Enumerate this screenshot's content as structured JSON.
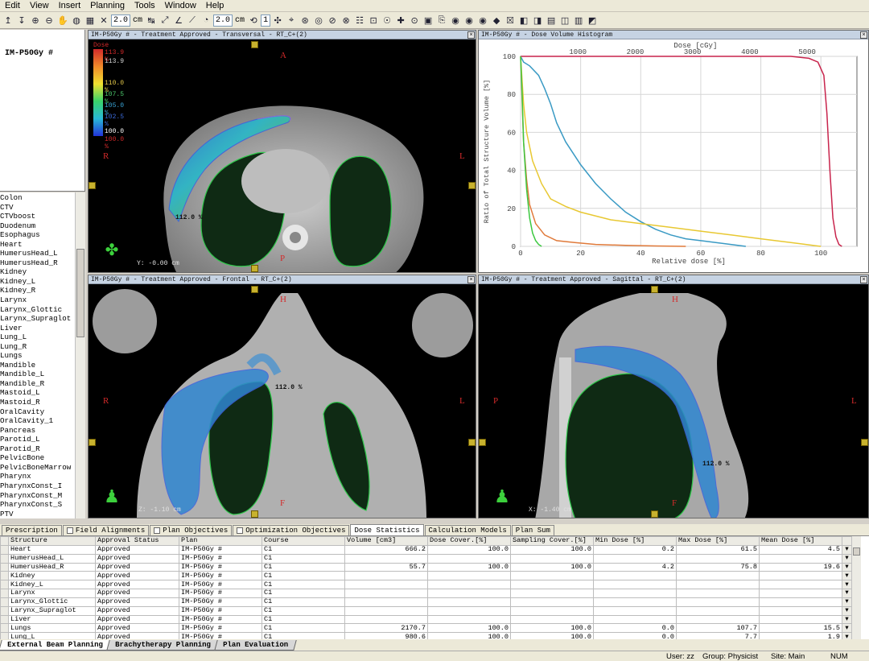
{
  "menu": [
    "Edit",
    "View",
    "Insert",
    "Planning",
    "Tools",
    "Window",
    "Help"
  ],
  "toolbar": {
    "zoom_value": "2.0",
    "zoom_unit": "cm",
    "dist_value": "2.0",
    "dist_unit": "cm",
    "index_value": "1"
  },
  "plan_name": "IM-P50Gy #",
  "structures": [
    "Colon",
    "CTV",
    "CTVboost",
    "Duodenum",
    "Esophagus",
    "Heart",
    "HumerusHead_L",
    "HumerusHead_R",
    "Kidney",
    "Kidney_L",
    "Kidney_R",
    "Larynx",
    "Larynx_Glottic",
    "Larynx_Supraglot",
    "Liver",
    "Lung_L",
    "Lung_R",
    "Lungs",
    "Mandible",
    "Mandible_L",
    "Mandible_R",
    "Mastoid_L",
    "Mastoid_R",
    "OralCavity",
    "OralCavity_1",
    "Pancreas",
    "Parotid_L",
    "Parotid_R",
    "PelvicBone",
    "PelvicBoneMarrow",
    "Pharynx",
    "PharynxConst_I",
    "PharynxConst_M",
    "PharynxConst_S",
    "PTV"
  ],
  "views": {
    "transversal": {
      "title": "IM-P50Gy #  -  Treatment Approved - Transversal - RT_C+(2)",
      "top": "A",
      "bottom": "P",
      "left": "R",
      "right": "L",
      "coord": "Y: -0.00 cm",
      "maxdose": "112.0 %"
    },
    "frontal": {
      "title": "IM-P50Gy #  -  Treatment Approved - Frontal - RT_C+(2)",
      "top": "H",
      "bottom": "F",
      "left": "R",
      "right": "L",
      "coord": "Z: -1.10 cm",
      "maxdose": "112.0 %"
    },
    "sagittal": {
      "title": "IM-P50Gy #  -  Treatment Approved - Sagittal - RT_C+(2)",
      "top": "H",
      "bottom": "F",
      "left": "P",
      "right": "L",
      "coord": "X: -1.40 cm",
      "maxdose": "112.0 %"
    }
  },
  "dose_legend": {
    "title": "Dose",
    "levels": [
      "113.9 %",
      "113.9",
      "110.0 %",
      "107.5 %",
      "105.0 %",
      "102.5 %",
      "100.0",
      "100.0 %"
    ]
  },
  "dvh": {
    "title": "IM-P50Gy #  -  Dose Volume Histogram",
    "chart_data": {
      "type": "line",
      "title": "",
      "xlabel": "Relative dose [%]",
      "x2label": "Dose [cGy]",
      "ylabel": "Ratio of Total Structure Volume [%]",
      "xlim": [
        0,
        112
      ],
      "ylim": [
        0,
        100
      ],
      "xticks": [
        0,
        20,
        40,
        60,
        80,
        100
      ],
      "x2ticks": [
        1000,
        2000,
        3000,
        4000,
        5000
      ],
      "yticks": [
        0,
        20,
        40,
        60,
        80,
        100
      ],
      "grid": true,
      "series": [
        {
          "color": "#c8244c",
          "points": [
            [
              0,
              100
            ],
            [
              90,
              100
            ],
            [
              96,
              99
            ],
            [
              99,
              97
            ],
            [
              101,
              90
            ],
            [
              102,
              70
            ],
            [
              103,
              40
            ],
            [
              104,
              15
            ],
            [
              105,
              5
            ],
            [
              106,
              1
            ],
            [
              107,
              0
            ]
          ]
        },
        {
          "color": "#3a9ac4",
          "points": [
            [
              0,
              100
            ],
            [
              1,
              97
            ],
            [
              3,
              95
            ],
            [
              6,
              90
            ],
            [
              8,
              83
            ],
            [
              10,
              75
            ],
            [
              12,
              65
            ],
            [
              15,
              55
            ],
            [
              20,
              43
            ],
            [
              25,
              33
            ],
            [
              30,
              25
            ],
            [
              35,
              18
            ],
            [
              40,
              13
            ],
            [
              45,
              9
            ],
            [
              50,
              6
            ],
            [
              55,
              4
            ],
            [
              60,
              3
            ],
            [
              65,
              2
            ],
            [
              70,
              1
            ],
            [
              75,
              0
            ]
          ]
        },
        {
          "color": "#e8c832",
          "points": [
            [
              0,
              100
            ],
            [
              1,
              75
            ],
            [
              2,
              60
            ],
            [
              4,
              45
            ],
            [
              7,
              33
            ],
            [
              10,
              25
            ],
            [
              15,
              21
            ],
            [
              20,
              18
            ],
            [
              30,
              14
            ],
            [
              40,
              12
            ],
            [
              50,
              10
            ],
            [
              60,
              8
            ],
            [
              70,
              6
            ],
            [
              80,
              4
            ],
            [
              90,
              2
            ],
            [
              95,
              1
            ],
            [
              100,
              0
            ]
          ]
        },
        {
          "color": "#e07a3a",
          "points": [
            [
              0,
              100
            ],
            [
              1,
              55
            ],
            [
              2,
              35
            ],
            [
              3,
              22
            ],
            [
              5,
              12
            ],
            [
              8,
              6
            ],
            [
              12,
              3
            ],
            [
              18,
              2
            ],
            [
              25,
              1
            ],
            [
              35,
              0.5
            ],
            [
              45,
              0.2
            ],
            [
              55,
              0
            ]
          ]
        },
        {
          "color": "#3cc840",
          "points": [
            [
              0,
              100
            ],
            [
              0.5,
              80
            ],
            [
              1,
              55
            ],
            [
              2,
              30
            ],
            [
              3,
              15
            ],
            [
              4,
              7
            ],
            [
              5,
              3
            ],
            [
              6,
              1
            ],
            [
              7,
              0
            ]
          ]
        }
      ]
    }
  },
  "tabs": [
    "Prescription",
    "Field Alignments",
    "Plan Objectives",
    "Optimization Objectives",
    "Dose Statistics",
    "Calculation Models",
    "Plan Sum"
  ],
  "active_tab": "Dose Statistics",
  "grid": {
    "headers": [
      "Structure",
      "Approval Status",
      "Plan",
      "Course",
      "Volume [cm3]",
      "Dose Cover.[%]",
      "Sampling Cover.[%]",
      "Min Dose [%]",
      "Max Dose [%]",
      "Mean Dose [%]"
    ],
    "rows": [
      [
        "Heart",
        "Approved",
        "IM-P50Gy #",
        "C1",
        "666.2",
        "100.0",
        "100.0",
        "0.2",
        "61.5",
        "4.5"
      ],
      [
        "HumerusHead_L",
        "Approved",
        "IM-P50Gy #",
        "C1",
        "",
        "",
        "",
        "",
        "",
        ""
      ],
      [
        "HumerusHead_R",
        "Approved",
        "IM-P50Gy #",
        "C1",
        "55.7",
        "100.0",
        "100.0",
        "4.2",
        "75.8",
        "19.6"
      ],
      [
        "Kidney",
        "Approved",
        "IM-P50Gy #",
        "C1",
        "",
        "",
        "",
        "",
        "",
        ""
      ],
      [
        "Kidney_L",
        "Approved",
        "IM-P50Gy #",
        "C1",
        "",
        "",
        "",
        "",
        "",
        ""
      ],
      [
        "Larynx",
        "Approved",
        "IM-P50Gy #",
        "C1",
        "",
        "",
        "",
        "",
        "",
        ""
      ],
      [
        "Larynx_Glottic",
        "Approved",
        "IM-P50Gy #",
        "C1",
        "",
        "",
        "",
        "",
        "",
        ""
      ],
      [
        "Larynx_Supraglot",
        "Approved",
        "IM-P50Gy #",
        "C1",
        "",
        "",
        "",
        "",
        "",
        ""
      ],
      [
        "Liver",
        "Approved",
        "IM-P50Gy #",
        "C1",
        "",
        "",
        "",
        "",
        "",
        ""
      ],
      [
        "Lungs",
        "Approved",
        "IM-P50Gy #",
        "C1",
        "2170.7",
        "100.0",
        "100.0",
        "0.0",
        "107.7",
        "15.5"
      ],
      [
        "Lung_L",
        "Approved",
        "IM-P50Gy #",
        "C1",
        "980.6",
        "100.0",
        "100.0",
        "0.0",
        "7.7",
        "1.9"
      ]
    ]
  },
  "modules": [
    "External Beam Planning",
    "Brachytherapy Planning",
    "Plan Evaluation"
  ],
  "status": {
    "user": "User: zz",
    "group": "Group: Physicist",
    "site": "Site: Main",
    "num": "NUM"
  }
}
